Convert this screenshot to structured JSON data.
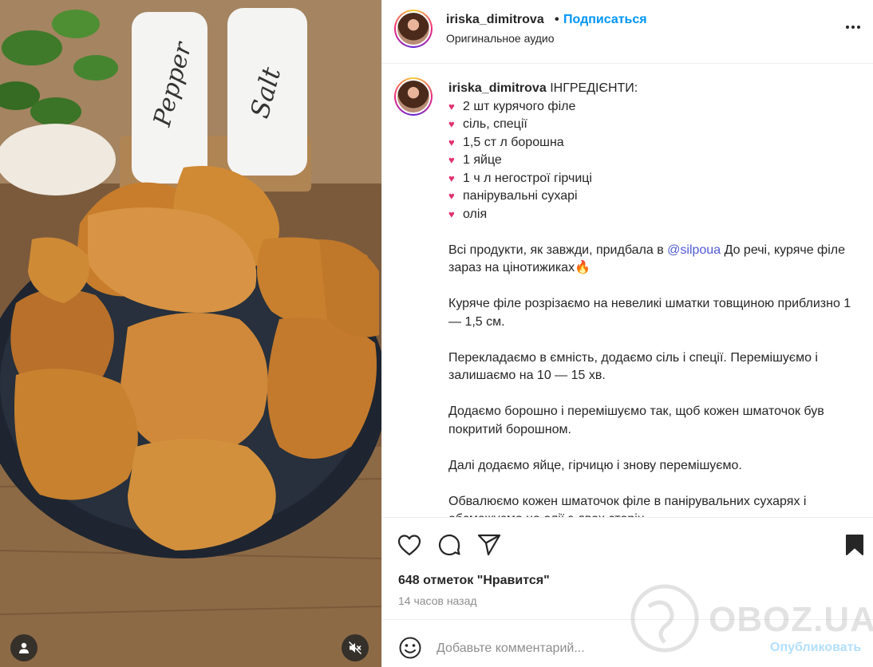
{
  "post": {
    "username": "iriska_dimitrova",
    "separator": "•",
    "follow_label": "Подписаться",
    "audio_label": "Оригинальное аудио",
    "more_icon": "more-horizontal-icon"
  },
  "caption": {
    "username": "iriska_dimitrova",
    "heading": "ІНГРЕДІЄНТИ:",
    "ingredients": [
      "2 шт курячого філе",
      "сіль, спеції",
      "1,5 ст л борошна",
      "1 яйце",
      "1 ч л негострої гірчиці",
      "панірувальні сухарі",
      "олія"
    ],
    "para1_before": "Всі продукти, як завжди, придбала в",
    "para1_mention": "@silpoua",
    "para1_after": "До речі, куряче філе зараз на цінотижиках",
    "para1_emoji": "🔥",
    "para2": "Куряче філе розрізаємо на невеликі шматки товщиною приблизно 1 — 1,5 см.",
    "para3": "Перекладаємо в ємність, додаємо сіль і спеції. Перемішуємо і залишаємо на 10 — 15 хв.",
    "para4": "Додаємо борошно і перемішуємо так, щоб кожен шматочок був покритий борошном.",
    "para5": "Далі додаємо яйце, гірчицю і знову перемішуємо.",
    "para6": "Обвалюємо кожен шматочок філе в панірувальних сухарях і обсмажуємо на олії з двох сторін."
  },
  "media": {
    "pepper_label": "Pepper",
    "salt_label": "Salt"
  },
  "actions": {
    "likes": "648 отметок \"Нравится\"",
    "timestamp": "14 часов назад"
  },
  "comment": {
    "placeholder": "Добавьте комментарий...",
    "publish_label": "Опубликовать"
  },
  "watermark": {
    "text": "OBOZ.UA"
  },
  "colors": {
    "accent": "#0095f6",
    "heart_bullet": "#e1306c",
    "publish_disabled": "#b2dffc"
  }
}
